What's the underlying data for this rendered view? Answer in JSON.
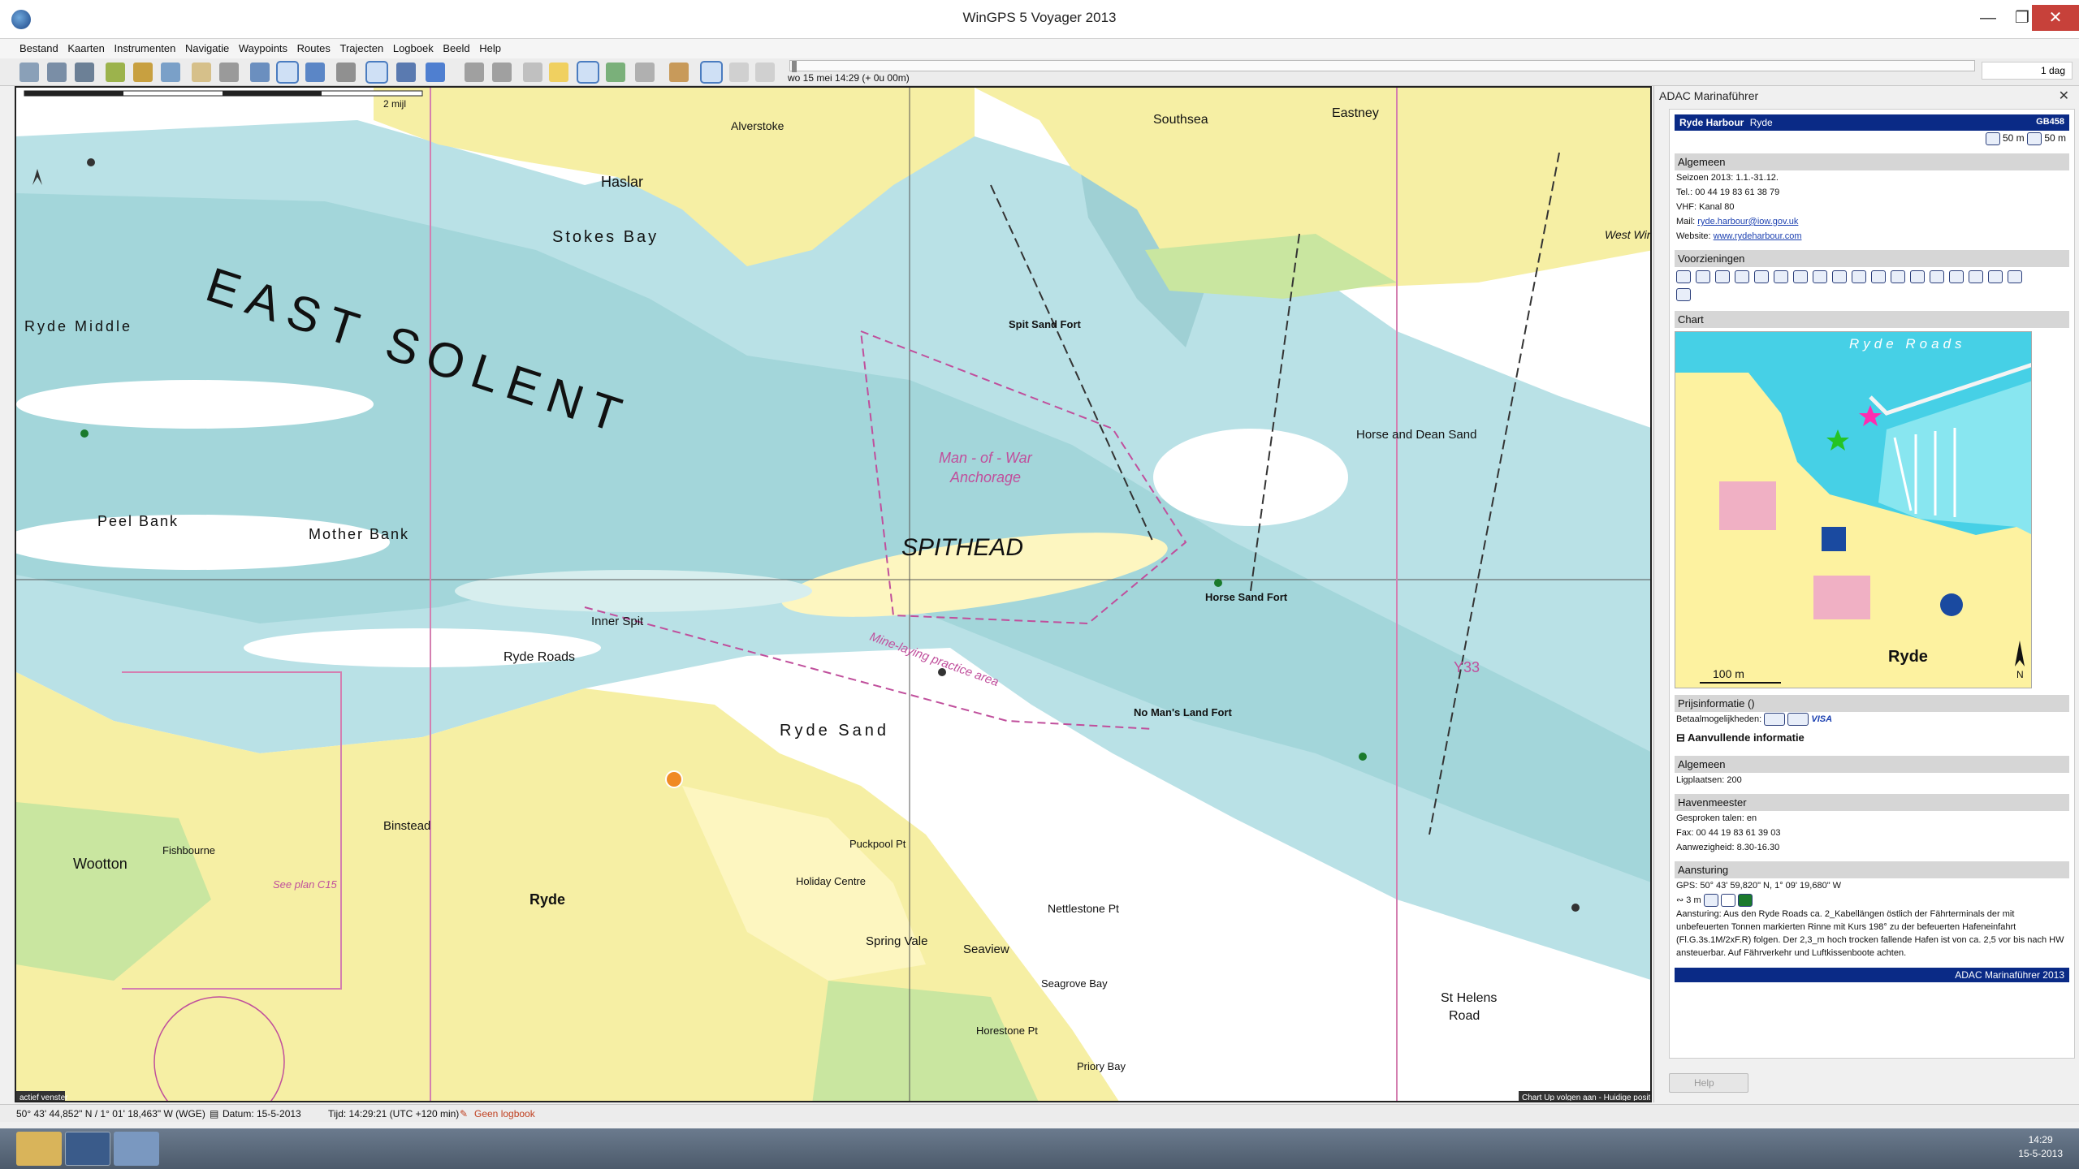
{
  "window": {
    "title": "WinGPS 5 Voyager 2013"
  },
  "menu": [
    "Bestand",
    "Kaarten",
    "Instrumenten",
    "Navigatie",
    "Waypoints",
    "Routes",
    "Trajecten",
    "Logboek",
    "Beeld",
    "Help"
  ],
  "timeline": {
    "label": "wo 15 mei 14:29  (+ 0u 00m)",
    "interval": "1 dag"
  },
  "map": {
    "scale_label": "2 mijl",
    "labels": {
      "east_solent": "EAST SOLENT",
      "spithead": "SPITHEAD",
      "ryde_sand": "Ryde Sand",
      "ryde": "Ryde",
      "binstead": "Binstead",
      "wootton": "Wootton",
      "haslar": "Haslar",
      "alverstoke": "Alverstoke",
      "southsea": "Southsea",
      "eastney": "Eastney",
      "stokes_bay": "Stokes Bay",
      "ryde_roads": "Ryde Roads",
      "mother_bank": "Mother Bank",
      "peel_bank": "Peel Bank",
      "ryde_middle": "Ryde Middle",
      "horse_and_dean_sand": "Horse and Dean Sand",
      "st_helens": "St Helens",
      "st_helens_road": "Road",
      "spring_vale": "Spring Vale",
      "seaview": "Seaview",
      "horse_sand_fort": "Horse Sand Fort",
      "no_mans_land_fort": "No Man's Land Fort",
      "spit_sand_fort": "Spit Sand Fort",
      "man_of_war": "Man - of - War",
      "anchorage": "Anchorage",
      "mine_laying": "Mine-laying practice area",
      "fishbourne": "Fishbourne",
      "nettlestone_pt": "Nettlestone Pt",
      "puckpool_pt": "Puckpool Pt",
      "horestone_pt": "Horestone Pt",
      "west_winner": "West Winner",
      "priory_bay": "Priory Bay",
      "seagrove_bay": "Seagrove Bay",
      "holiday_centre": "Holiday Centre",
      "inner_spit": "Inner Spit",
      "see_plan": "See plan C15",
      "y33": "Y33",
      "active_window": "actief venster",
      "chart_up": "Chart Up volgen aan - Huidige positie"
    }
  },
  "status": {
    "position": "50° 43' 44,852\" N / 1° 01' 18,463\" W (WGE)",
    "date": "Datum: 15-5-2013",
    "time": "Tijd: 14:29:21 (UTC +120 min)",
    "logbook": "Geen logbook"
  },
  "panel": {
    "title": "ADAC Marinaführer",
    "harbour": "Ryde Harbour",
    "harbour_sub": "Ryde",
    "code": "GB458",
    "depth1": "50 m",
    "depth2": "50 m",
    "sections": {
      "algemeen": "Algemeen",
      "voorzieningen": "Voorzieningen",
      "chart": "Chart",
      "prijsinfo": "Prijsinformatie ()",
      "aanvullend": "Aanvullende informatie",
      "algemeen2": "Algemeen",
      "havenmeester": "Havenmeester",
      "aansturing": "Aansturing"
    },
    "info": {
      "seizoen": "Seizoen 2013: 1.1.-31.12.",
      "tel": "Tel.: 00 44 19 83 61 38 79",
      "vhf": "VHF: Kanal 80",
      "mail_label": "Mail:",
      "mail": "ryde.harbour@iow.gov.uk",
      "website_label": "Website:",
      "website": "www.rydeharbour.com",
      "betaal": "Betaalmogelijkheden:",
      "visa": "VISA",
      "ligplaatsen": "Ligplaatsen: 200",
      "talen": "Gesproken talen: en",
      "fax": "Fax: 00 44 19 83 61 39 03",
      "aanwezigheid": "Aanwezigheid: 8.30-16.30",
      "gps": "GPS: 50° 43' 59,820\" N, 1° 09' 19,680\" W",
      "depth": "3 m",
      "aansturing": "Aansturing: Aus den Ryde Roads ca. 2_Kabellängen östlich der Fährterminals der mit unbefeuerten Tonnen markierten Rinne mit Kurs 198° zu der befeuerten Hafeneinfahrt (Fl.G.3s.1M/2xF.R) folgen. Der 2,3_m hoch trocken fallende Hafen ist von ca. 2,5 vor bis nach HW ansteuerbar. Auf Fährverkehr und Luftkissenboote achten."
    },
    "chart": {
      "roads_label": "Ryde Roads",
      "town_label": "Ryde",
      "scale_label": "100 m",
      "north": "N"
    },
    "footer": "ADAC Marinaführer 2013",
    "help": "Help"
  },
  "taskbar": {
    "time": "14:29",
    "date": "15-5-2013"
  }
}
